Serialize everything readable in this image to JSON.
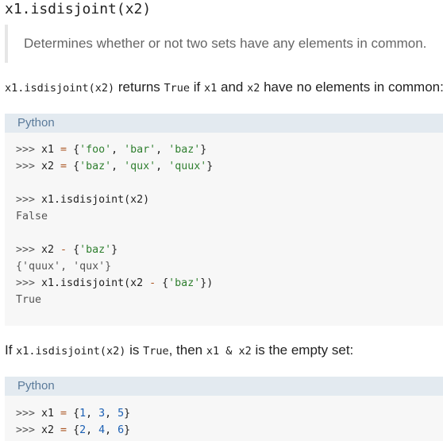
{
  "heading": "x1.isdisjoint(x2)",
  "blockquote": "Determines whether or not two sets have any elements in common.",
  "intro": {
    "code1": "x1.isdisjoint(x2)",
    "t1": " returns ",
    "code2": "True",
    "t2": " if ",
    "code3": "x1",
    "t3": " and ",
    "code4": "x2",
    "t4": " have no elements in common:"
  },
  "block1": {
    "lang": "Python",
    "lines": {
      "l1": {
        "prompt": ">>> ",
        "a": "x1",
        "b": " = ",
        "c": "{",
        "d": "'foo'",
        "e": ", ",
        "f": "'bar'",
        "g": ", ",
        "h": "'baz'",
        "i": "}"
      },
      "l2": {
        "prompt": ">>> ",
        "a": "x2",
        "b": " = ",
        "c": "{",
        "d": "'baz'",
        "e": ", ",
        "f": "'qux'",
        "g": ", ",
        "h": "'quux'",
        "i": "}"
      },
      "l3": {
        "prompt": ">>> ",
        "a": "x1.isdisjoint(x2)"
      },
      "l4": {
        "out": "False"
      },
      "l5": {
        "prompt": ">>> ",
        "a": "x2",
        "b": " - ",
        "c": "{",
        "d": "'baz'",
        "e": "}"
      },
      "l6": {
        "a": "{",
        "b": "'quux'",
        "c": ", ",
        "d": "'qux'",
        "e": "}"
      },
      "l7": {
        "prompt": ">>> ",
        "a": "x1.isdisjoint(x2",
        "b": " - ",
        "c": "{",
        "d": "'baz'",
        "e": "})"
      },
      "l8": {
        "out": "True"
      }
    }
  },
  "para2": {
    "t1": "If ",
    "code1": "x1.isdisjoint(x2)",
    "t2": " is ",
    "code2": "True",
    "t3": ", then ",
    "code3": "x1 & x2",
    "t4": " is the empty set:"
  },
  "block2": {
    "lang": "Python",
    "lines": {
      "l1": {
        "prompt": ">>> ",
        "a": "x1",
        "b": " = ",
        "c": "{",
        "d": "1",
        "e": ", ",
        "f": "3",
        "g": ", ",
        "h": "5",
        "i": "}"
      },
      "l2": {
        "prompt": ">>> ",
        "a": "x2",
        "b": " = ",
        "c": "{",
        "d": "2",
        "e": ", ",
        "f": "4",
        "g": ", ",
        "h": "6",
        "i": "}"
      }
    }
  },
  "colors": {
    "code_bg": "#f7f7f7",
    "code_header_bg": "#e3eaf0",
    "lang_label": "#5a7a9a",
    "string": "#2f7f2f",
    "number": "#1a5fb4",
    "operator": "#aa5522"
  }
}
